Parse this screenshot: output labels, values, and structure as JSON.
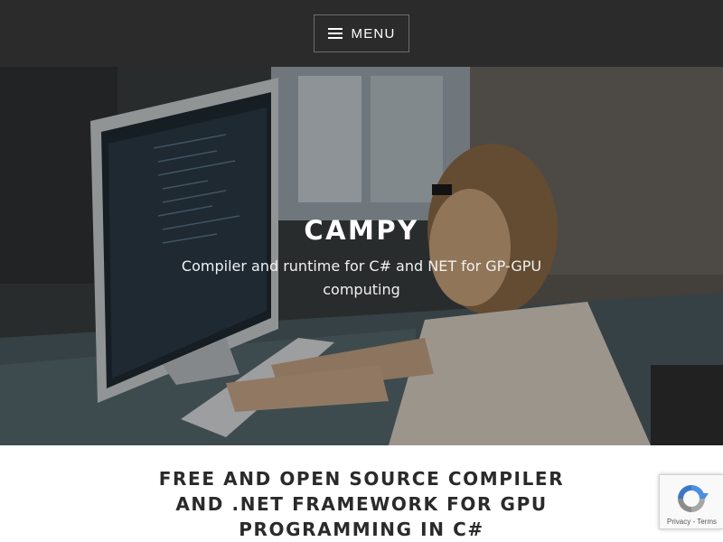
{
  "header": {
    "menu_label": "MENU"
  },
  "hero": {
    "site_title": "CAMPY",
    "tagline": "Compiler and runtime for C# and NET for GP-GPU computing"
  },
  "content": {
    "heading": "FREE AND OPEN SOURCE COMPILER AND .NET FRAMEWORK FOR GPU PROGRAMMING IN C#"
  },
  "recaptcha": {
    "privacy_label": "Privacy",
    "separator": " - ",
    "terms_label": "Terms"
  },
  "colors": {
    "header_bg": "#2b2b2b",
    "text_dark": "#2a2a2a",
    "text_light": "#ffffff",
    "recaptcha_blue": "#4a90e2"
  },
  "icons": {
    "menu": "hamburger-icon",
    "recaptcha": "recaptcha-logo-icon"
  }
}
